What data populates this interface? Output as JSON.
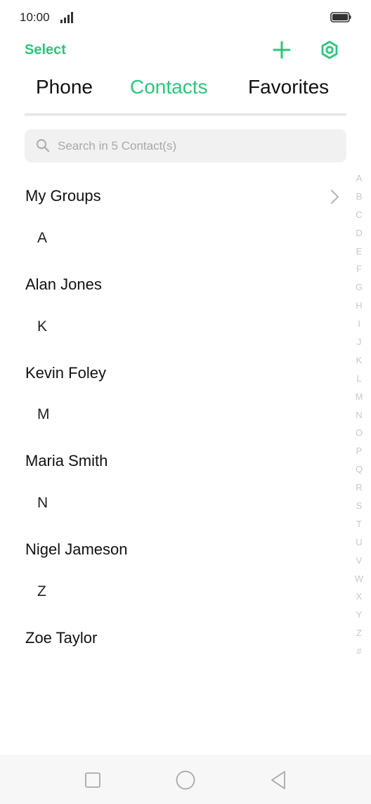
{
  "status_bar": {
    "time": "10:00"
  },
  "header": {
    "select_label": "Select",
    "add_icon": "plus-icon",
    "settings_icon": "settings-hexagon-icon"
  },
  "tabs": [
    {
      "label": "Phone",
      "active": false
    },
    {
      "label": "Contacts",
      "active": true
    },
    {
      "label": "Favorites",
      "active": false
    }
  ],
  "search": {
    "placeholder": "Search in 5 Contact(s)"
  },
  "groups": {
    "label": "My Groups"
  },
  "sections": [
    {
      "letter": "A",
      "contacts": [
        "Alan Jones"
      ]
    },
    {
      "letter": "K",
      "contacts": [
        "Kevin Foley"
      ]
    },
    {
      "letter": "M",
      "contacts": [
        "Maria Smith"
      ]
    },
    {
      "letter": "N",
      "contacts": [
        "Nigel Jameson"
      ]
    },
    {
      "letter": "Z",
      "contacts": [
        "Zoe Taylor"
      ]
    }
  ],
  "alpha_index": [
    "A",
    "B",
    "C",
    "D",
    "E",
    "F",
    "G",
    "H",
    "I",
    "J",
    "K",
    "L",
    "M",
    "N",
    "O",
    "P",
    "Q",
    "R",
    "S",
    "T",
    "U",
    "V",
    "W",
    "X",
    "Y",
    "Z",
    "#"
  ],
  "colors": {
    "accent": "#2dc57b",
    "search_bg": "#f1f1f1",
    "index_text": "#c8c8c8"
  }
}
